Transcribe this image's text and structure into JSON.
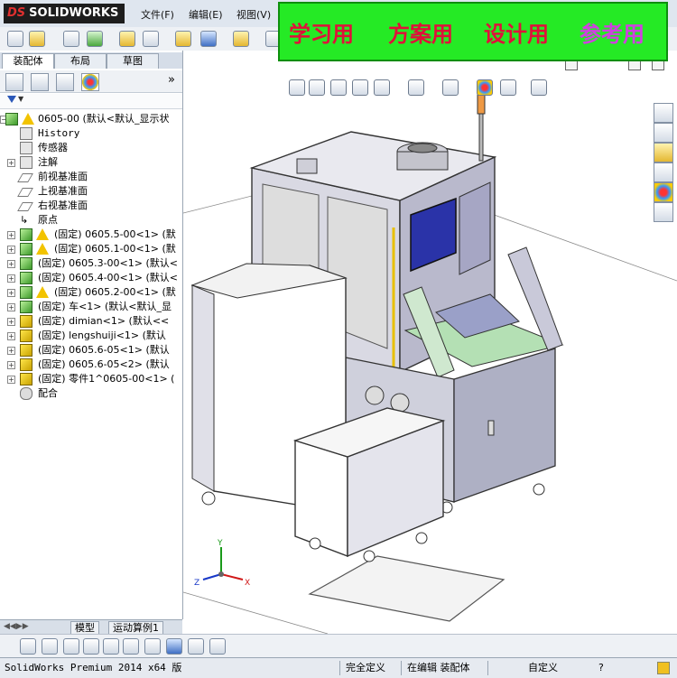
{
  "app": {
    "logo_text": "SOLIDWORKS",
    "logo_mark": "DS",
    "menus": [
      "文件(F)",
      "编辑(E)",
      "视图(V)"
    ]
  },
  "banner": {
    "words": [
      "学习用",
      "方案用",
      "设计用",
      "参考用"
    ],
    "colors": [
      "#e0103a",
      "#e0103a",
      "#e0103a",
      "#d040e0"
    ],
    "background": "#25ea25"
  },
  "panel": {
    "tabs": [
      "装配体",
      "布局",
      "草图"
    ],
    "expand_label": "»",
    "filter_icon": "filter-icon"
  },
  "tree": {
    "root": "0605-00  (默认<默认_显示状",
    "items": [
      {
        "label": "History",
        "icon": "history-icon",
        "type": "fold"
      },
      {
        "label": "传感器",
        "icon": "sensor-icon",
        "type": "fold"
      },
      {
        "label": "注解",
        "icon": "annotation-icon",
        "type": "fold",
        "expand": true
      },
      {
        "label": "前视基准面",
        "icon": "plane-icon",
        "type": "plane"
      },
      {
        "label": "上视基准面",
        "icon": "plane-icon",
        "type": "plane"
      },
      {
        "label": "右视基准面",
        "icon": "plane-icon",
        "type": "plane"
      },
      {
        "label": "原点",
        "icon": "origin-icon",
        "type": "origin"
      },
      {
        "label": "(固定) 0605.5-00<1> (默",
        "icon": "assembly-icon",
        "type": "asmwarn",
        "expand": true
      },
      {
        "label": "(固定) 0605.1-00<1> (默",
        "icon": "assembly-icon",
        "type": "asmwarn",
        "expand": true
      },
      {
        "label": "(固定) 0605.3-00<1> (默认<",
        "icon": "assembly-icon",
        "type": "asm",
        "expand": true
      },
      {
        "label": "(固定) 0605.4-00<1> (默认<",
        "icon": "assembly-icon",
        "type": "asm",
        "expand": true
      },
      {
        "label": "(固定) 0605.2-00<1> (默",
        "icon": "assembly-icon",
        "type": "asmwarn",
        "expand": true
      },
      {
        "label": "(固定) 车<1> (默认<默认_显",
        "icon": "assembly-icon",
        "type": "asm",
        "expand": true
      },
      {
        "label": "(固定) dimian<1> (默认<<",
        "icon": "part-icon",
        "type": "part",
        "expand": true
      },
      {
        "label": "(固定) lengshuiji<1> (默认",
        "icon": "part-icon",
        "type": "part",
        "expand": true
      },
      {
        "label": "(固定) 0605.6-05<1> (默认",
        "icon": "part-icon",
        "type": "part",
        "expand": true
      },
      {
        "label": "(固定) 0605.6-05<2> (默认",
        "icon": "part-icon",
        "type": "part",
        "expand": true
      },
      {
        "label": "(固定) 零件1^0605-00<1> (",
        "icon": "part-icon",
        "type": "part",
        "expand": true
      },
      {
        "label": "配合",
        "icon": "mates-icon",
        "type": "mates"
      }
    ]
  },
  "bottom_tabs": [
    "模型",
    "运动算例1"
  ],
  "status": {
    "app_version": "SolidWorks Premium 2014 x64 版",
    "definition": "完全定义",
    "editing": "在编辑 装配体",
    "units": "自定义",
    "help": "?"
  },
  "axes": {
    "x": "X",
    "y": "Y",
    "z": "Z"
  }
}
